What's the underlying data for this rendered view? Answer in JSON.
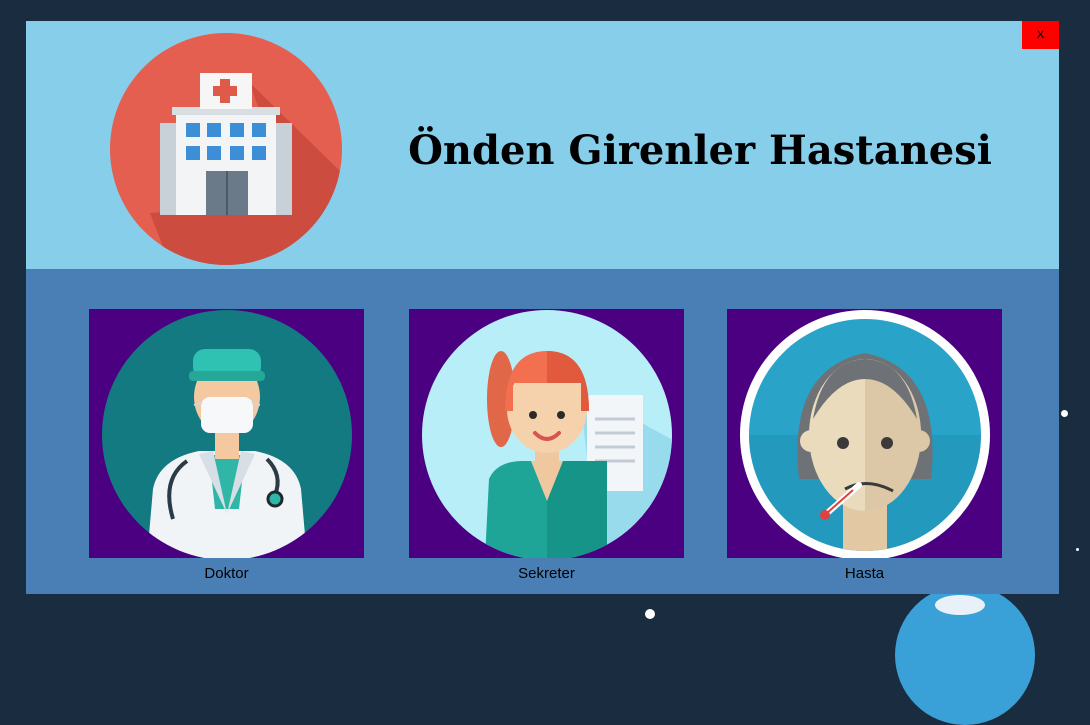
{
  "app": {
    "title": "Önden Girenler Hastanesi",
    "close_label": "X"
  },
  "roles": [
    {
      "label": "Doktor",
      "icon": "doctor-icon"
    },
    {
      "label": "Sekreter",
      "icon": "secretary-icon"
    },
    {
      "label": "Hasta",
      "icon": "patient-icon"
    }
  ],
  "colors": {
    "header_bg": "#87ceeb",
    "body_bg": "#4a7fb5",
    "card_bg": "#4b0082",
    "close_bg": "#ff0000",
    "desktop_bg": "#1a2d40"
  },
  "icons": {
    "logo": "hospital-icon"
  }
}
